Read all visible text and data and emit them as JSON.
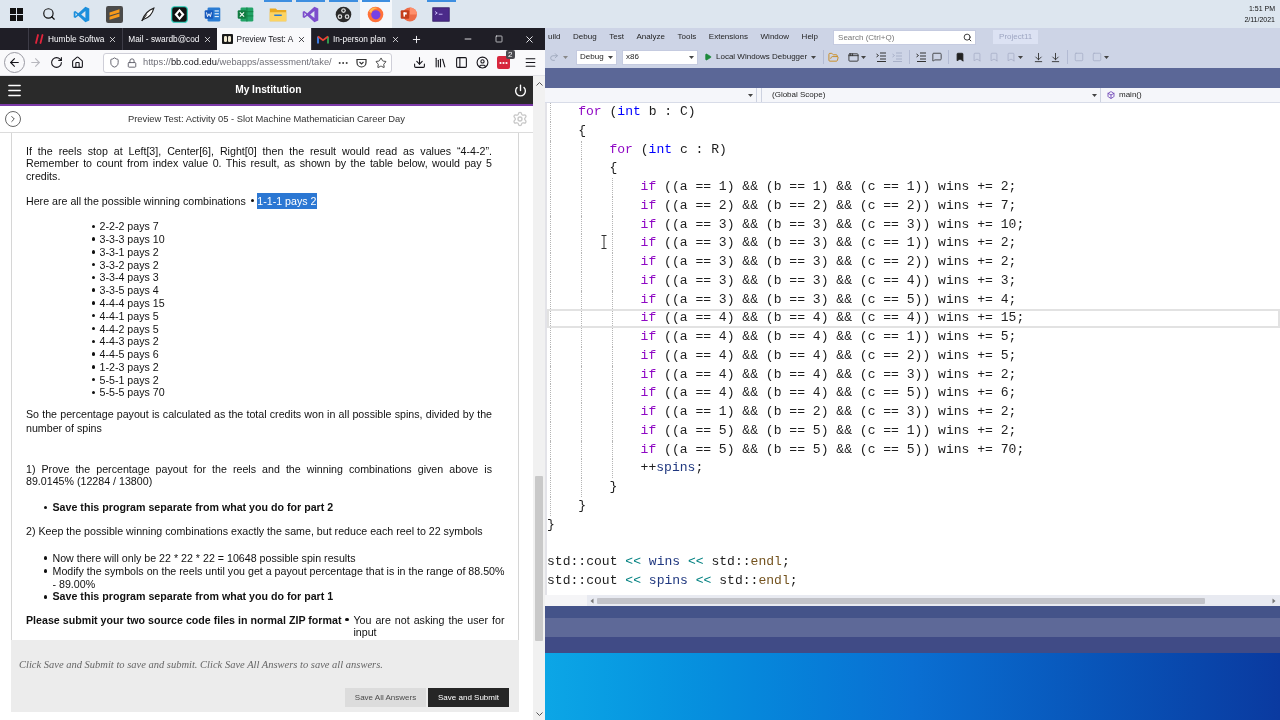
{
  "taskbar": {
    "apps": [
      {
        "kind": "start",
        "running": false,
        "selected": false
      },
      {
        "kind": "search",
        "running": false,
        "selected": false
      },
      {
        "kind": "code-editor",
        "running": false,
        "selected": false
      },
      {
        "kind": "text-editor",
        "running": false,
        "selected": false
      },
      {
        "kind": "tex",
        "running": false,
        "selected": false
      },
      {
        "kind": "git",
        "running": false,
        "selected": false
      },
      {
        "kind": "word",
        "running": false,
        "selected": false
      },
      {
        "kind": "sheet",
        "running": false,
        "selected": false
      },
      {
        "kind": "folder",
        "running": true,
        "selected": false
      },
      {
        "kind": "ide",
        "running": true,
        "selected": false
      },
      {
        "kind": "recorder",
        "running": true,
        "selected": false
      },
      {
        "kind": "browser",
        "running": true,
        "selected": true
      },
      {
        "kind": "slides",
        "running": false,
        "selected": false
      },
      {
        "kind": "terminal",
        "running": true,
        "selected": false
      }
    ],
    "clock": {
      "time": "1:51 PM",
      "date": "2/11/2021"
    }
  },
  "browser": {
    "tabs": [
      {
        "title": "Humble Softwa",
        "selected": false
      },
      {
        "title": "Mail - swardb@cod",
        "selected": false
      },
      {
        "title": "Preview Test: A",
        "selected": true
      },
      {
        "title": "In-person plan",
        "selected": false
      }
    ],
    "nav_buttons": [
      {
        "kind": "back",
        "disabled": false
      },
      {
        "kind": "forward",
        "disabled": true
      },
      {
        "kind": "reload",
        "disabled": false
      },
      {
        "kind": "home",
        "disabled": false
      }
    ],
    "url": {
      "scheme": "https://",
      "domain": "bb.cod.edu",
      "path": "/webapps/assessment/take/"
    },
    "extension_badge": "2"
  },
  "page": {
    "site_title": "My Institution",
    "test_title": "Preview Test: Activity 05 - Slot Machine Mathematician Career Day",
    "intro": "If the reels stop at Left[3], Center[6], Right[0] then the result would read as values “4-4-2”. Remember to count from index value 0. This result, as shown by the table below, would pay 5 credits.",
    "combinations_intro": "Here are all the possible winning combinations",
    "combinations": [
      {
        "text": "1-1-1 pays 2",
        "selected": true
      },
      {
        "text": "2-2-2 pays 7",
        "selected": false
      },
      {
        "text": "3-3-3 pays 10",
        "selected": false
      },
      {
        "text": "3-3-1 pays 2",
        "selected": false
      },
      {
        "text": "3-3-2 pays 2",
        "selected": false
      },
      {
        "text": "3-3-4 pays 3",
        "selected": false
      },
      {
        "text": "3-3-5 pays 4",
        "selected": false
      },
      {
        "text": "4-4-4 pays 15",
        "selected": false
      },
      {
        "text": "4-4-1 pays 5",
        "selected": false
      },
      {
        "text": "4-4-2 pays 5",
        "selected": false
      },
      {
        "text": "4-4-3 pays 2",
        "selected": false
      },
      {
        "text": "4-4-5 pays 6",
        "selected": false
      },
      {
        "text": "1-2-3 pays 2",
        "selected": false
      },
      {
        "text": "5-5-1 pays 2",
        "selected": false
      },
      {
        "text": "5-5-5 pays 70",
        "selected": false
      }
    ],
    "payout_text": "So the percentage payout is calculated as the total credits won in all possible spins, divided by the number of spins",
    "tasks": [
      {
        "text": "1) Prove the percentage payout for the reels and the winning combinations given above is 89.0145% (12284 / 13800)",
        "bullets": [
          {
            "text": "Save this program separate from what you do for part 2",
            "kind": "note"
          }
        ]
      },
      {
        "text": "2) Keep the possible winning combinations exactly the same, but reduce each reel to 22 symbols",
        "bullets": [
          {
            "text": "Now there will only be 22 * 22 * 22 = 10648 possible spin results",
            "kind": "plain"
          },
          {
            "text": "Modify the symbols on the reels until you get a payout percentage that is in the range of 88.50% - 89.00%",
            "kind": "plain"
          },
          {
            "text": "Save this program separate from what you do for part 1",
            "kind": "note"
          }
        ]
      }
    ],
    "submit_note": {
      "text": "Please submit your two source code files in normal ZIP format",
      "bullet": "You are not asking the user for input"
    },
    "footer_hint": "Click Save and Submit to save and submit. Click Save All Answers to save all answers.",
    "buttons": [
      {
        "label": "Save All Answers",
        "kind": "secondary"
      },
      {
        "label": "Save and Submit",
        "kind": "primary"
      }
    ]
  },
  "vs": {
    "menu": [
      "uild",
      "Debug",
      "Test",
      "Analyze",
      "Tools",
      "Extensions",
      "Window",
      "Help"
    ],
    "search": {
      "placeholder": "Search (Ctrl+Q)"
    },
    "project": "Project11",
    "toolbar": {
      "configuration": "Debug",
      "platform": "x86",
      "run_label": "Local Windows Debugger"
    },
    "nav": {
      "scope": "(Global Scope)",
      "member": "main()"
    },
    "code_blocks": [
      {
        "lines": [
          {
            "children": [
              {
                "tokens": [
                  {
                    "text": "for",
                    "kind": "control"
                  },
                  {
                    "text": " (",
                    "kind": "plain"
                  },
                  {
                    "text": "int",
                    "kind": "keyword"
                  },
                  {
                    "text": " b : C)",
                    "kind": "plain"
                  }
                ],
                "current": false
              },
              {
                "tokens": [
                  {
                    "text": "{",
                    "kind": "plain"
                  }
                ],
                "current": false
              },
              {
                "children": [
                  {
                    "tokens": [
                      {
                        "text": "for",
                        "kind": "control"
                      },
                      {
                        "text": " (",
                        "kind": "plain"
                      },
                      {
                        "text": "int",
                        "kind": "keyword"
                      },
                      {
                        "text": " c : R)",
                        "kind": "plain"
                      }
                    ],
                    "current": false
                  },
                  {
                    "tokens": [
                      {
                        "text": "{",
                        "kind": "plain"
                      }
                    ],
                    "current": false
                  },
                  {
                    "children": [
                      {
                        "tokens": [
                          {
                            "text": "if",
                            "kind": "control"
                          },
                          {
                            "text": " ((a == 1) && (b == 1) && (c == 1)) wins += 2;",
                            "kind": "plain"
                          }
                        ],
                        "current": false
                      },
                      {
                        "tokens": [
                          {
                            "text": "if",
                            "kind": "control"
                          },
                          {
                            "text": " ((a == 2) && (b == 2) && (c == 2)) wins += 7;",
                            "kind": "plain"
                          }
                        ],
                        "current": false
                      },
                      {
                        "tokens": [
                          {
                            "text": "if",
                            "kind": "control"
                          },
                          {
                            "text": " ((a == 3) && (b == 3) && (c == 3)) wins += 10;",
                            "kind": "plain"
                          }
                        ],
                        "current": false
                      },
                      {
                        "tokens": [
                          {
                            "text": "if",
                            "kind": "control"
                          },
                          {
                            "text": " ((a == 3) && (b == 3) && (c == 1)) wins += 2;",
                            "kind": "plain"
                          }
                        ],
                        "current": false
                      },
                      {
                        "tokens": [
                          {
                            "text": "if",
                            "kind": "control"
                          },
                          {
                            "text": " ((a == 3) && (b == 3) && (c == 2)) wins += 2;",
                            "kind": "plain"
                          }
                        ],
                        "current": false
                      },
                      {
                        "tokens": [
                          {
                            "text": "if",
                            "kind": "control"
                          },
                          {
                            "text": " ((a == 3) && (b == 3) && (c == 4)) wins += 3;",
                            "kind": "plain"
                          }
                        ],
                        "current": false
                      },
                      {
                        "tokens": [
                          {
                            "text": "if",
                            "kind": "control"
                          },
                          {
                            "text": " ((a == 3) && (b == 3) && (c == 5)) wins += 4;",
                            "kind": "plain"
                          }
                        ],
                        "current": false
                      },
                      {
                        "tokens": [
                          {
                            "text": "if",
                            "kind": "control"
                          },
                          {
                            "text": " ((a == 4) && (b == 4) && (c == 4)) wins += 15;",
                            "kind": "plain"
                          }
                        ],
                        "current": true
                      },
                      {
                        "tokens": [
                          {
                            "text": "if",
                            "kind": "control"
                          },
                          {
                            "text": " ((a == 4) && (b == 4) && (c == 1)) wins += 5;",
                            "kind": "plain"
                          }
                        ],
                        "current": false
                      },
                      {
                        "tokens": [
                          {
                            "text": "if",
                            "kind": "control"
                          },
                          {
                            "text": " ((a == 4) && (b == 4) && (c == 2)) wins += 5;",
                            "kind": "plain"
                          }
                        ],
                        "current": false
                      },
                      {
                        "tokens": [
                          {
                            "text": "if",
                            "kind": "control"
                          },
                          {
                            "text": " ((a == 4) && (b == 4) && (c == 3)) wins += 2;",
                            "kind": "plain"
                          }
                        ],
                        "current": false
                      },
                      {
                        "tokens": [
                          {
                            "text": "if",
                            "kind": "control"
                          },
                          {
                            "text": " ((a == 4) && (b == 4) && (c == 5)) wins += 6;",
                            "kind": "plain"
                          }
                        ],
                        "current": false
                      },
                      {
                        "tokens": [
                          {
                            "text": "if",
                            "kind": "control"
                          },
                          {
                            "text": " ((a == 1) && (b == 2) && (c == 3)) wins += 2;",
                            "kind": "plain"
                          }
                        ],
                        "current": false
                      },
                      {
                        "tokens": [
                          {
                            "text": "if",
                            "kind": "control"
                          },
                          {
                            "text": " ((a == 5) && (b == 5) && (c == 1)) wins += 2;",
                            "kind": "plain"
                          }
                        ],
                        "current": false
                      },
                      {
                        "tokens": [
                          {
                            "text": "if",
                            "kind": "control"
                          },
                          {
                            "text": " ((a == 5) && (b == 5) && (c == 5)) wins += 70;",
                            "kind": "plain"
                          }
                        ],
                        "current": false
                      },
                      {
                        "tokens": [
                          {
                            "text": "++",
                            "kind": "plain"
                          },
                          {
                            "text": "spins",
                            "kind": "variable"
                          },
                          {
                            "text": ";",
                            "kind": "plain"
                          }
                        ],
                        "current": false
                      }
                    ]
                  },
                  {
                    "tokens": [
                      {
                        "text": "}",
                        "kind": "plain"
                      }
                    ],
                    "current": false
                  }
                ]
              },
              {
                "tokens": [
                  {
                    "text": "}",
                    "kind": "plain"
                  }
                ],
                "current": false
              }
            ]
          },
          {
            "tokens": [
              {
                "text": "}",
                "kind": "plain"
              }
            ],
            "current": false
          }
        ]
      },
      {
        "lines": [
          {
            "tokens": [
              {
                "text": "std::cout ",
                "kind": "plain"
              },
              {
                "text": "<<",
                "kind": "operator"
              },
              {
                "text": " wins ",
                "kind": "variable"
              },
              {
                "text": "<<",
                "kind": "operator"
              },
              {
                "text": " std::",
                "kind": "plain"
              },
              {
                "text": "endl",
                "kind": "function"
              },
              {
                "text": ";",
                "kind": "plain"
              }
            ],
            "current": false
          },
          {
            "tokens": [
              {
                "text": "std::cout ",
                "kind": "plain"
              },
              {
                "text": "<<",
                "kind": "operator"
              },
              {
                "text": " spins ",
                "kind": "variable"
              },
              {
                "text": "<<",
                "kind": "operator"
              },
              {
                "text": " std::",
                "kind": "plain"
              },
              {
                "text": "endl",
                "kind": "function"
              },
              {
                "text": ";",
                "kind": "plain"
              }
            ],
            "current": false
          }
        ]
      }
    ]
  }
}
